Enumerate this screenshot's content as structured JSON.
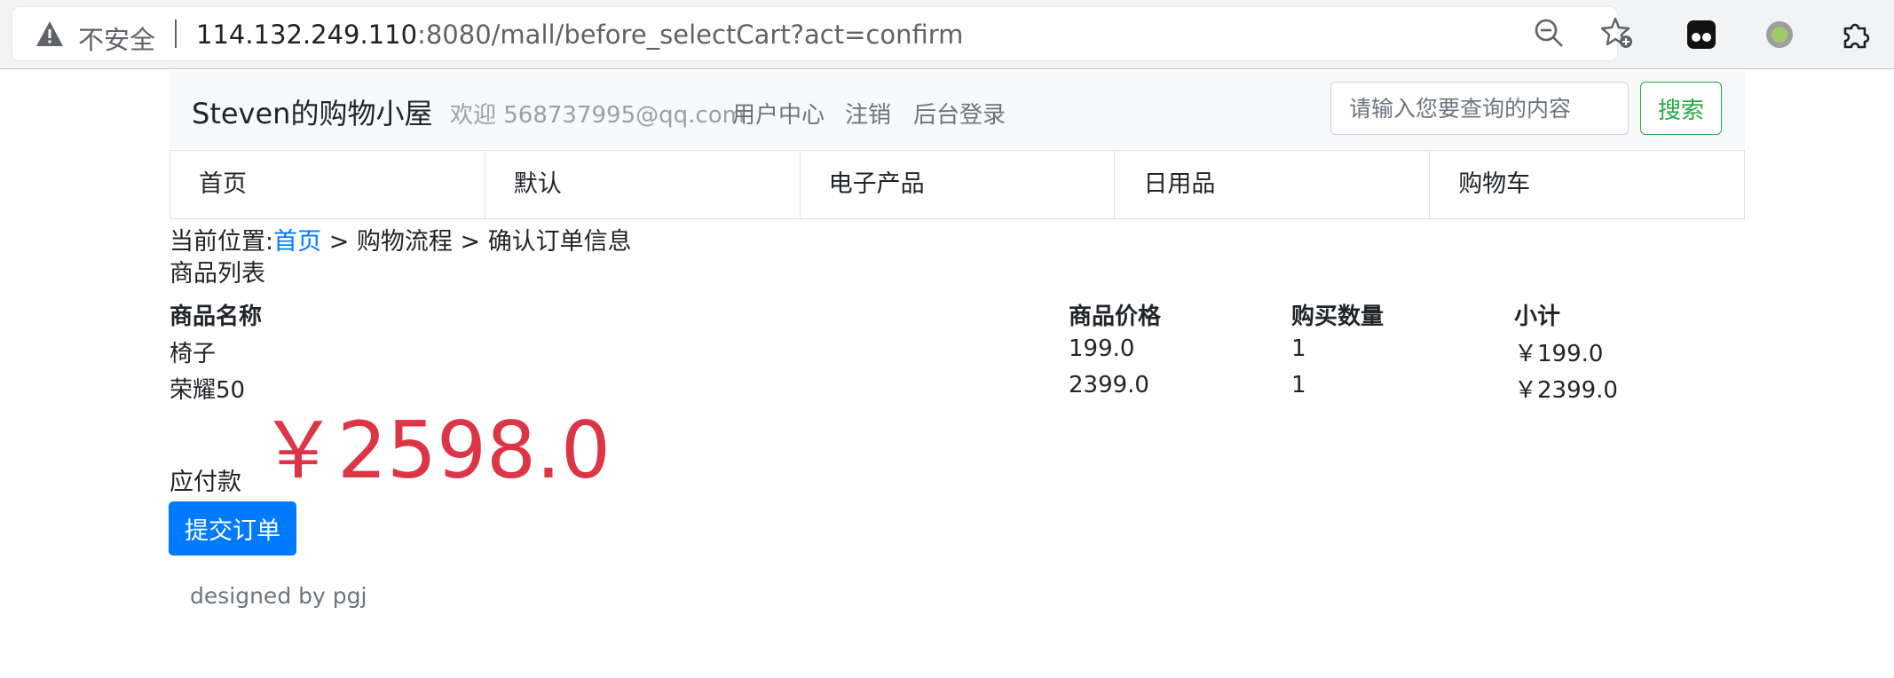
{
  "browser": {
    "security_label": "不安全",
    "url_host": "114.132.249.110",
    "url_rest": ":8080/mall/before_selectCart?act=confirm",
    "icons": [
      "warning-icon",
      "zoom-out-icon",
      "favorite-star-icon",
      "extension-icon",
      "profile-icon",
      "puzzle-extensions-icon"
    ]
  },
  "header": {
    "brand": "Steven的购物小屋",
    "welcome": "欢迎 568737995@qq.com",
    "links": [
      "用户中心",
      "注销",
      "后台登录"
    ],
    "search_placeholder": "请输入您要查询的内容",
    "search_button": "搜索"
  },
  "tabs": [
    "首页",
    "默认",
    "电子产品",
    "日用品",
    "购物车"
  ],
  "breadcrumb": {
    "prefix": "当前位置:",
    "home": "首页",
    "sep1": " > 购物流程 > ",
    "current": "确认订单信息"
  },
  "list_title": "商品列表",
  "table": {
    "headers": [
      "商品名称",
      "商品价格",
      "购买数量",
      "小计"
    ],
    "rows": [
      [
        "椅子",
        "199.0",
        "1",
        "￥199.0"
      ],
      [
        "荣耀50",
        "2399.0",
        "1",
        "￥2399.0"
      ]
    ]
  },
  "payment": {
    "label": "应付款",
    "amount": "￥2598.0"
  },
  "submit_button": "提交订单",
  "footer": "designed by pgj",
  "colors": {
    "link": "#007bff",
    "primary": "#007bff",
    "danger": "#dc3545",
    "success": "#28a745"
  }
}
